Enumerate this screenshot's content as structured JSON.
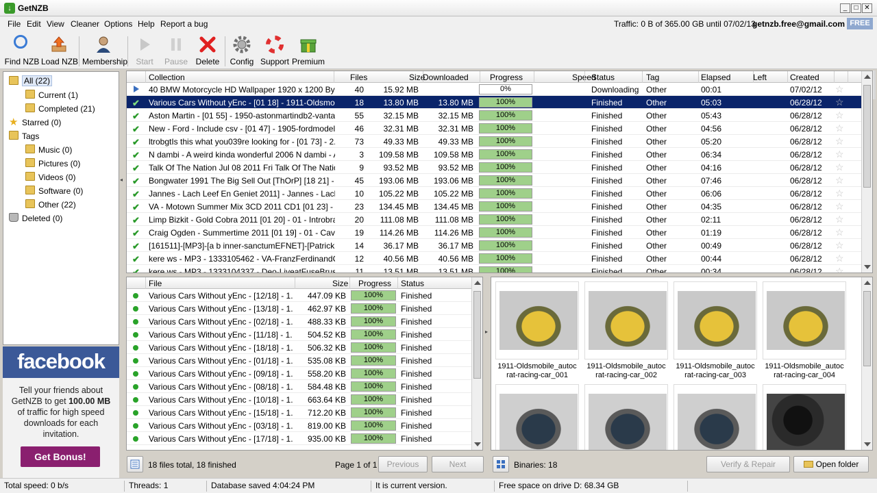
{
  "window": {
    "title": "GetNZB"
  },
  "menu": [
    "File",
    "Edit",
    "View",
    "Cleaner",
    "Options",
    "Help",
    "Report a bug"
  ],
  "header": {
    "traffic": "Traffic: 0 B of 365.00 GB until 07/02/13",
    "email": "getnzb.free@gmail.com",
    "plan": "FREE"
  },
  "toolbar": {
    "find_nzb": "Find NZB",
    "load_nzb": "Load NZB",
    "membership": "Membership",
    "start": "Start",
    "pause": "Pause",
    "delete": "Delete",
    "config": "Config",
    "support": "Support",
    "premium": "Premium"
  },
  "sidebar": {
    "items": [
      {
        "label": "All (22)",
        "level": 0,
        "icon": "folder-icon",
        "selected": true
      },
      {
        "label": "Current (1)",
        "level": 1,
        "icon": "folder-icon"
      },
      {
        "label": "Completed (21)",
        "level": 1,
        "icon": "folder-icon"
      },
      {
        "label": "Starred (0)",
        "level": 0,
        "icon": "star-icon"
      },
      {
        "label": "Tags",
        "level": 0,
        "icon": "folder-icon"
      },
      {
        "label": "Music (0)",
        "level": 1,
        "icon": "folder-icon"
      },
      {
        "label": "Pictures (0)",
        "level": 1,
        "icon": "folder-icon"
      },
      {
        "label": "Videos (0)",
        "level": 1,
        "icon": "folder-icon"
      },
      {
        "label": "Software (0)",
        "level": 1,
        "icon": "folder-icon"
      },
      {
        "label": "Other (22)",
        "level": 1,
        "icon": "folder-icon"
      },
      {
        "label": "Deleted (0)",
        "level": 0,
        "icon": "trash-icon"
      }
    ]
  },
  "promo": {
    "logo": "facebook",
    "text1": "Tell your friends about",
    "text2_prefix": "GetNZB to get",
    "text2_bold": "100.00 MB",
    "text3": "of traffic for high speed",
    "text4": "downloads for each",
    "text5": "invitation.",
    "button": "Get Bonus!"
  },
  "collections": {
    "columns": [
      "Collection",
      "Files",
      "Size",
      "Downloaded",
      "Progress",
      "Speed",
      "Status",
      "Tag",
      "Elapsed",
      "Left",
      "Created"
    ],
    "rows": [
      {
        "name": "40 BMW Motorcycle HD Wallpaper 1920 x 1200 By H...",
        "files": "40",
        "size": "15.92 MB",
        "downloaded": "",
        "progress": "0%",
        "pct": 0,
        "status": "Downloading",
        "tag": "Other",
        "elapsed": "00:01",
        "created": "07/02/12",
        "state": "downloading"
      },
      {
        "name": "Various Cars Without yEnc - [01 18] - 1911-Oldsmob...",
        "files": "18",
        "size": "13.80 MB",
        "downloaded": "13.80 MB",
        "progress": "100%",
        "pct": 100,
        "status": "Finished",
        "tag": "Other",
        "elapsed": "05:03",
        "created": "06/28/12",
        "state": "selected"
      },
      {
        "name": "Aston Martin - [01 55] - 1950-astonmartindb2-vanta...",
        "files": "55",
        "size": "32.15 MB",
        "downloaded": "32.15 MB",
        "progress": "100%",
        "pct": 100,
        "status": "Finished",
        "tag": "Other",
        "elapsed": "05:43",
        "created": "06/28/12"
      },
      {
        "name": "New - Ford - Include csv - [01 47] - 1905-fordmodel-...",
        "files": "46",
        "size": "32.31 MB",
        "downloaded": "32.31 MB",
        "progress": "100%",
        "pct": 100,
        "status": "Finished",
        "tag": "Other",
        "elapsed": "04:56",
        "created": "06/28/12"
      },
      {
        "name": "ltrobgtIs this what you039re looking for - [01 73] - 2...",
        "files": "73",
        "size": "49.33 MB",
        "downloaded": "49.33 MB",
        "progress": "100%",
        "pct": 100,
        "status": "Finished",
        "tag": "Other",
        "elapsed": "05:20",
        "created": "06/28/12"
      },
      {
        "name": "N dambi - A weird kinda wonderful 2006 N dambi - A ...",
        "files": "3",
        "size": "109.58 MB",
        "downloaded": "109.58 MB",
        "progress": "100%",
        "pct": 100,
        "status": "Finished",
        "tag": "Other",
        "elapsed": "06:34",
        "created": "06/28/12"
      },
      {
        "name": "Talk Of The Nation Jul 08 2011 Fri Talk Of The Natio...",
        "files": "9",
        "size": "93.52 MB",
        "downloaded": "93.52 MB",
        "progress": "100%",
        "pct": 100,
        "status": "Finished",
        "tag": "Other",
        "elapsed": "04:16",
        "created": "06/28/12"
      },
      {
        "name": "Bongwater 1991 The Big Sell Out [ThOrP] [18 21] - ...",
        "files": "45",
        "size": "193.06 MB",
        "downloaded": "193.06 MB",
        "progress": "100%",
        "pct": 100,
        "status": "Finished",
        "tag": "Other",
        "elapsed": "07:46",
        "created": "06/28/12"
      },
      {
        "name": "Jannes - Lach Leef En Geniet 2011] - Jannes - Lach ...",
        "files": "10",
        "size": "105.22 MB",
        "downloaded": "105.22 MB",
        "progress": "100%",
        "pct": 100,
        "status": "Finished",
        "tag": "Other",
        "elapsed": "06:06",
        "created": "06/28/12"
      },
      {
        "name": "VA - Motown Summer Mix 3CD 2011 CD1 [01 23] - 0...",
        "files": "23",
        "size": "134.45 MB",
        "downloaded": "134.45 MB",
        "progress": "100%",
        "pct": 100,
        "status": "Finished",
        "tag": "Other",
        "elapsed": "04:35",
        "created": "06/28/12"
      },
      {
        "name": "Limp Bizkit - Gold Cobra 2011 [01 20] - 01 - Introbra ...",
        "files": "20",
        "size": "111.08 MB",
        "downloaded": "111.08 MB",
        "progress": "100%",
        "pct": 100,
        "status": "Finished",
        "tag": "Other",
        "elapsed": "02:11",
        "created": "06/28/12"
      },
      {
        "name": "Craig Ogden - Summertime 2011 [01 19] - 01 - Cava...",
        "files": "19",
        "size": "114.26 MB",
        "downloaded": "114.26 MB",
        "progress": "100%",
        "pct": 100,
        "status": "Finished",
        "tag": "Other",
        "elapsed": "01:19",
        "created": "06/28/12"
      },
      {
        "name": "[161511]-[MP3]-[a b inner-sanctumEFNET]-[Patrick...",
        "files": "14",
        "size": "36.17 MB",
        "downloaded": "36.17 MB",
        "progress": "100%",
        "pct": 100,
        "status": "Finished",
        "tag": "Other",
        "elapsed": "00:49",
        "created": "06/28/12"
      },
      {
        "name": "kere ws - MP3 - 1333105462 - VA-FranzFerdinandCo...",
        "files": "12",
        "size": "40.56 MB",
        "downloaded": "40.56 MB",
        "progress": "100%",
        "pct": 100,
        "status": "Finished",
        "tag": "Other",
        "elapsed": "00:44",
        "created": "06/28/12"
      },
      {
        "name": "kere ws - MP3 - 1333104337 - Deo-LiveatFuseBruss...",
        "files": "11",
        "size": "13.51 MB",
        "downloaded": "13.51 MB",
        "progress": "100%",
        "pct": 100,
        "status": "Finished",
        "tag": "Other",
        "elapsed": "00:34",
        "created": "06/28/12"
      }
    ]
  },
  "files": {
    "columns": [
      "File",
      "Size",
      "Progress",
      "Status"
    ],
    "rows": [
      {
        "name": "Various Cars Without yEnc - [12/18] - 1...",
        "size": "447.09 KB",
        "progress": "100%",
        "pct": 100,
        "status": "Finished"
      },
      {
        "name": "Various Cars Without yEnc - [13/18] - 1...",
        "size": "462.97 KB",
        "progress": "100%",
        "pct": 100,
        "status": "Finished"
      },
      {
        "name": "Various Cars Without yEnc - [02/18] - 1...",
        "size": "488.33 KB",
        "progress": "100%",
        "pct": 100,
        "status": "Finished"
      },
      {
        "name": "Various Cars Without yEnc - [11/18] - 1...",
        "size": "504.52 KB",
        "progress": "100%",
        "pct": 100,
        "status": "Finished"
      },
      {
        "name": "Various Cars Without yEnc - [18/18] - 1...",
        "size": "506.32 KB",
        "progress": "100%",
        "pct": 100,
        "status": "Finished"
      },
      {
        "name": "Various Cars Without yEnc - [01/18] - 1...",
        "size": "535.08 KB",
        "progress": "100%",
        "pct": 100,
        "status": "Finished"
      },
      {
        "name": "Various Cars Without yEnc - [09/18] - 1...",
        "size": "558.20 KB",
        "progress": "100%",
        "pct": 100,
        "status": "Finished"
      },
      {
        "name": "Various Cars Without yEnc - [08/18] - 1...",
        "size": "584.48 KB",
        "progress": "100%",
        "pct": 100,
        "status": "Finished"
      },
      {
        "name": "Various Cars Without yEnc - [10/18] - 1...",
        "size": "663.64 KB",
        "progress": "100%",
        "pct": 100,
        "status": "Finished"
      },
      {
        "name": "Various Cars Without yEnc - [15/18] - 1...",
        "size": "712.20 KB",
        "progress": "100%",
        "pct": 100,
        "status": "Finished"
      },
      {
        "name": "Various Cars Without yEnc - [03/18] - 1...",
        "size": "819.00 KB",
        "progress": "100%",
        "pct": 100,
        "status": "Finished"
      },
      {
        "name": "Various Cars Without yEnc - [17/18] - 1...",
        "size": "935.00 KB",
        "progress": "100%",
        "pct": 100,
        "status": "Finished"
      }
    ]
  },
  "images": [
    {
      "caption1": "1911-Oldsmobile_autoc",
      "caption2": "rat-racing-car_001",
      "style": "yellow"
    },
    {
      "caption1": "1911-Oldsmobile_autoc",
      "caption2": "rat-racing-car_002",
      "style": "yellow"
    },
    {
      "caption1": "1911-Oldsmobile_autoc",
      "caption2": "rat-racing-car_003",
      "style": "yellow"
    },
    {
      "caption1": "1911-Oldsmobile_autoc",
      "caption2": "rat-racing-car_004",
      "style": "yellow"
    },
    {
      "caption1": "",
      "caption2": "",
      "style": "dark"
    },
    {
      "caption1": "",
      "caption2": "",
      "style": "dark"
    },
    {
      "caption1": "",
      "caption2": "",
      "style": "dark"
    },
    {
      "caption1": "",
      "caption2": "",
      "style": "interior"
    }
  ],
  "files_footer": {
    "summary": "18 files total, 18 finished",
    "page": "Page 1 of 1",
    "previous": "Previous",
    "next": "Next"
  },
  "images_footer": {
    "binaries": "Binaries: 18",
    "verify": "Verify & Repair",
    "open_folder": "Open folder"
  },
  "statusbar": {
    "speed": "Total speed: 0 b/s",
    "threads": "Threads: 1",
    "db": "Database saved 4:04:24 PM",
    "version": "It is current version.",
    "free_space": "Free space on drive D: 68.34 GB"
  },
  "colors": {
    "selection": "#0a246a",
    "progress_fill": "#9fd08a",
    "facebook": "#3b5998",
    "bonus_button": "#8a1f6f"
  }
}
